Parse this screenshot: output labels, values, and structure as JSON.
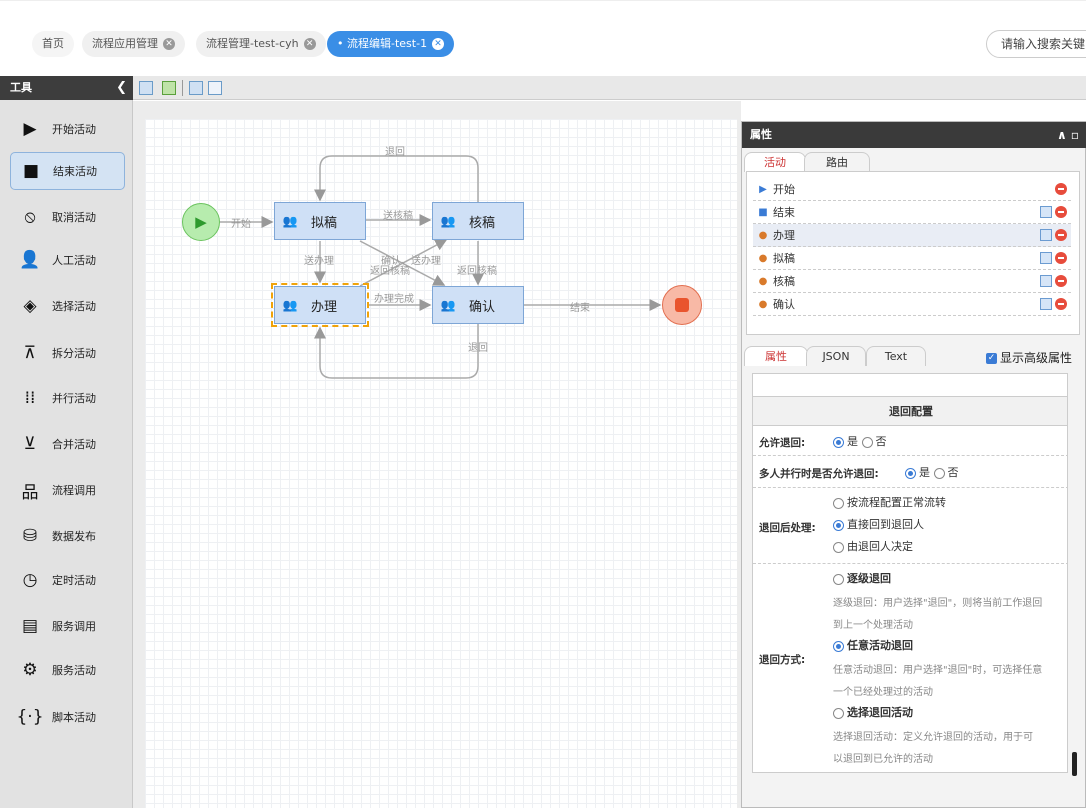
{
  "tabs": [
    {
      "label": "首页",
      "closable": false
    },
    {
      "label": "流程应用管理",
      "closable": true
    },
    {
      "label": "流程管理-test-cyh",
      "closable": true
    },
    {
      "label": "流程编辑-test-1",
      "closable": true,
      "active": true
    }
  ],
  "search": {
    "placeholder": "请输入搜索关键"
  },
  "toolbox": {
    "title": "工具",
    "items": [
      {
        "label": "开始活动",
        "icon": "play-icon"
      },
      {
        "label": "结束活动",
        "icon": "stop-icon",
        "selected": true
      },
      {
        "label": "取消活动",
        "icon": "cancel-icon"
      },
      {
        "label": "人工活动",
        "icon": "person-icon"
      },
      {
        "label": "选择活动",
        "icon": "choice-icon"
      },
      {
        "label": "拆分活动",
        "icon": "split-icon"
      },
      {
        "label": "并行活动",
        "icon": "parallel-icon"
      },
      {
        "label": "合并活动",
        "icon": "merge-icon"
      },
      {
        "label": "流程调用",
        "icon": "subprocess-icon"
      },
      {
        "label": "数据发布",
        "icon": "database-icon"
      },
      {
        "label": "定时活动",
        "icon": "clock-icon"
      },
      {
        "label": "服务调用",
        "icon": "service-call-icon"
      },
      {
        "label": "服务活动",
        "icon": "gears-icon"
      },
      {
        "label": "脚本活动",
        "icon": "code-icon"
      }
    ]
  },
  "diagram": {
    "nodes": {
      "draft": "拟稿",
      "review": "核稿",
      "handle": "办理",
      "confirm": "确认"
    },
    "edges": {
      "start": "开始",
      "send_review": "送核稿",
      "back_top": "退回",
      "send_handle": "送办理",
      "return_review_a": "返回核稿",
      "confirm_send": "确认、送办理",
      "return_review_b": "返回核稿",
      "handle_done": "办理完成",
      "end": "结束",
      "back_bottom": "退回"
    }
  },
  "panel": {
    "title": "属性",
    "tabs_top": [
      "活动",
      "路由"
    ],
    "activities": [
      {
        "label": "开始",
        "icon": "triangle-icon",
        "ops": [
          "delete"
        ]
      },
      {
        "label": "结束",
        "icon": "square-icon",
        "ops": [
          "copy",
          "delete"
        ]
      },
      {
        "label": "办理",
        "icon": "person-icon",
        "ops": [
          "copy",
          "delete"
        ],
        "highlight": true
      },
      {
        "label": "拟稿",
        "icon": "person-icon",
        "ops": [
          "copy",
          "delete"
        ]
      },
      {
        "label": "核稿",
        "icon": "person-icon",
        "ops": [
          "copy",
          "delete"
        ]
      },
      {
        "label": "确认",
        "icon": "person-icon",
        "ops": [
          "copy",
          "delete"
        ]
      }
    ],
    "tabs_bottom": [
      "属性",
      "JSON",
      "Text"
    ],
    "advanced_label": "显示高级属性",
    "form": {
      "section": "退回配置",
      "allow_back": {
        "label": "允许退回:",
        "yes": "是",
        "no": "否",
        "value": "yes"
      },
      "parallel_back": {
        "label": "多人并行时是否允许退回:",
        "yes": "是",
        "no": "否",
        "value": "yes"
      },
      "after_back": {
        "label": "退回后处理:",
        "options": [
          "按流程配置正常流转",
          "直接回到退回人",
          "由退回人决定"
        ],
        "selected": 1
      },
      "back_mode": {
        "label": "退回方式:",
        "options": [
          {
            "title": "逐级退回",
            "desc1": "逐级退回：用户选择\"退回\"，则将当前工作退回",
            "desc2": "到上一个处理活动"
          },
          {
            "title": "任意活动退回",
            "desc1": "任意活动退回：用户选择\"退回\"时，可选择任意",
            "desc2": "一个已经处理过的活动"
          },
          {
            "title": "选择退回活动",
            "desc1": "选择退回活动：定义允许退回的活动，用于可",
            "desc2": "以退回到已允许的活动"
          }
        ],
        "selected": 1
      }
    }
  }
}
